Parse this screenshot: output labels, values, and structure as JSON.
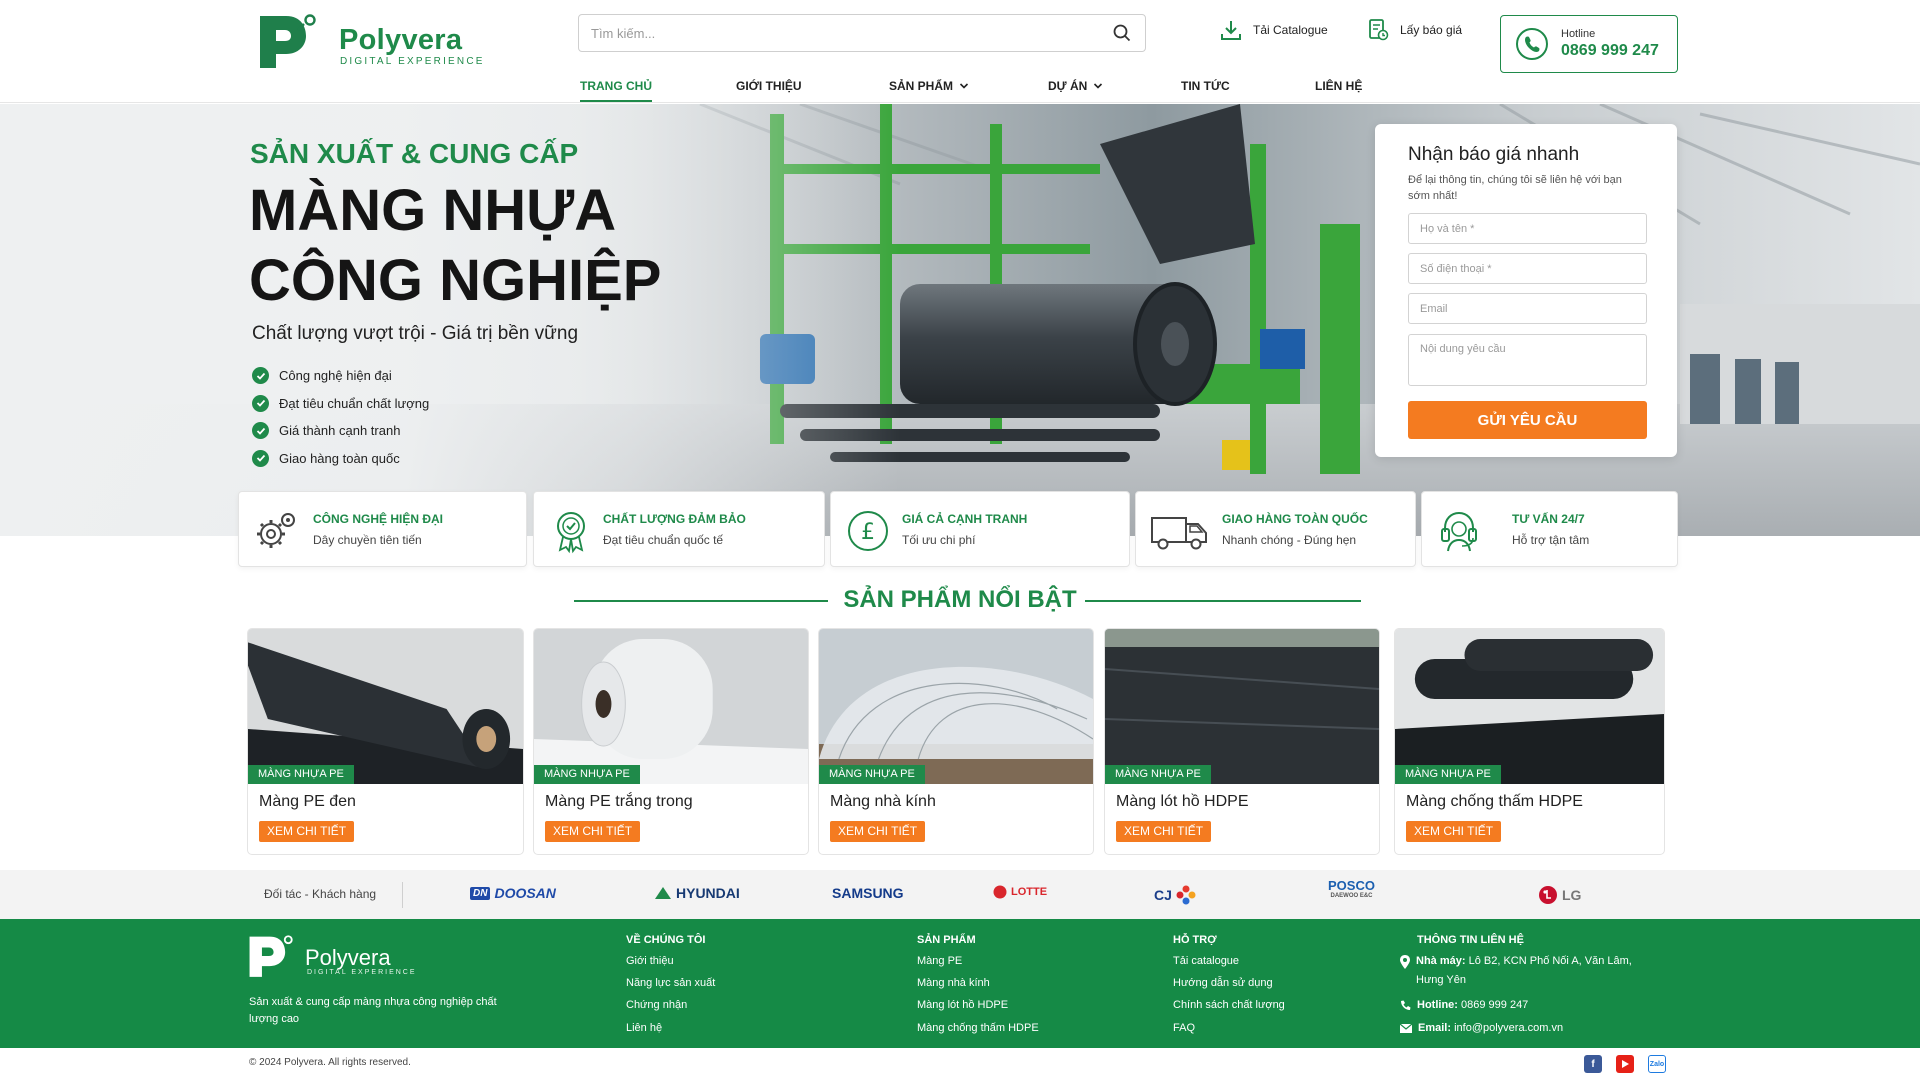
{
  "brand": {
    "name": "Polyvera",
    "tagline": "DIGITAL EXPERIENCE",
    "green": "#1f8a4a",
    "orange": "#f47b20"
  },
  "header": {
    "search_placeholder": "Tìm kiếm...",
    "catalogue": "Tải Catalogue",
    "quote_link": "Lấy báo giá",
    "hotline_label": "Hotline",
    "hotline_number": "0869 999 247"
  },
  "nav": [
    "TRANG CHỦ",
    "GIỚI THIỆU",
    "SẢN PHẨM",
    "DỰ ÁN",
    "TIN TỨC",
    "LIÊN HỆ"
  ],
  "hero": {
    "kicker": "SẢN XUẤT & CUNG CẤP",
    "title_line1": "MÀNG NHỰA",
    "title_line2": "CÔNG NGHIỆP",
    "subtitle": "Chất lượng vượt trội - Giá trị bền vững",
    "bullets": [
      "Công nghệ hiện đại",
      "Đạt tiêu chuẩn chất lượng",
      "Giá thành cạnh tranh",
      "Giao hàng toàn quốc"
    ]
  },
  "quote_form": {
    "title": "Nhận báo giá nhanh",
    "desc": "Để lại thông tin, chúng tôi sẽ liên hệ với bạn sớm nhất!",
    "name_placeholder": "Họ và tên *",
    "phone_placeholder": "Số điện thoại *",
    "email_placeholder": "Email",
    "message_placeholder": "Nội dung yêu cầu",
    "submit": "GỬI YÊU CẦU"
  },
  "features": [
    {
      "title": "CÔNG NGHỆ HIỆN ĐẠI",
      "sub": "Dây chuyền tiên tiến",
      "icon": "gears-icon"
    },
    {
      "title": "CHẤT LƯỢNG ĐẢM BẢO",
      "sub": "Đạt tiêu chuẩn quốc tế",
      "icon": "award-icon"
    },
    {
      "title": "GIÁ CẢ CẠNH TRANH",
      "sub": "Tối ưu chi phí",
      "icon": "pound-coin-icon"
    },
    {
      "title": "GIAO HÀNG TOÀN QUỐC",
      "sub": "Nhanh chóng - Đúng hẹn",
      "icon": "truck-icon"
    },
    {
      "title": "TƯ VẤN 24/7",
      "sub": "Hỗ trợ tận tâm",
      "icon": "headset-icon"
    }
  ],
  "products_title": "SẢN PHẨM NỔI BẬT",
  "products": [
    {
      "tag": "MÀNG NHỰA PE",
      "name": "Màng PE đen",
      "button": "XEM CHI TIẾT"
    },
    {
      "tag": "MÀNG NHỰA PE",
      "name": "Màng PE trắng  trong",
      "button": "XEM CHI TIẾT"
    },
    {
      "tag": "MÀNG NHỰA PE",
      "name": "Màng nhà kính",
      "button": "XEM CHI TIẾT"
    },
    {
      "tag": "MÀNG NHỰA PE",
      "name": "Màng lót hồ HDPE",
      "button": "XEM CHI TIẾT"
    },
    {
      "tag": "MÀNG NHỰA PE",
      "name": "Màng chống thấm HDPE",
      "button": "XEM CHI TIẾT"
    }
  ],
  "partners": {
    "label": "Đối tác - Khách hàng",
    "logos": [
      "DOOSAN",
      "HYUNDAI",
      "SAMSUNG",
      "LOTTE",
      "CJ",
      "POSCO",
      "DAEWOO E&C",
      "LG"
    ]
  },
  "footer": {
    "desc": "Sản xuất & cung cấp màng nhựa công nghiệp chất lượng cao",
    "cols": [
      {
        "title": "VỀ CHÚNG TÔI",
        "items": [
          "Giới thiệu",
          "Năng lực sản xuất",
          "Chứng nhận",
          "Liên hệ"
        ]
      },
      {
        "title": "SẢN PHẨM",
        "items": [
          "Màng PE",
          "Màng nhà kính",
          "Màng lót hồ HDPE",
          "Màng chống thấm HDPE"
        ]
      },
      {
        "title": "HỖ TRỢ",
        "items": [
          "Tải catalogue",
          "Hướng dẫn sử dụng",
          "Chính sách chất lượng",
          "FAQ"
        ]
      }
    ],
    "contact": {
      "title": "THÔNG TIN LIÊN HỆ",
      "factory_label": "Nhà máy:",
      "factory_line1": "Lô B2, KCN Phố Nối A, Văn Lâm,",
      "factory_line2": "Hưng Yên",
      "hotline_label": "Hotline:",
      "hotline": "0869 999 247",
      "email_label": "Email:",
      "email": "info@polyvera.com.vn"
    },
    "copyright": "© 2024 Polyvera. All rights reserved."
  }
}
